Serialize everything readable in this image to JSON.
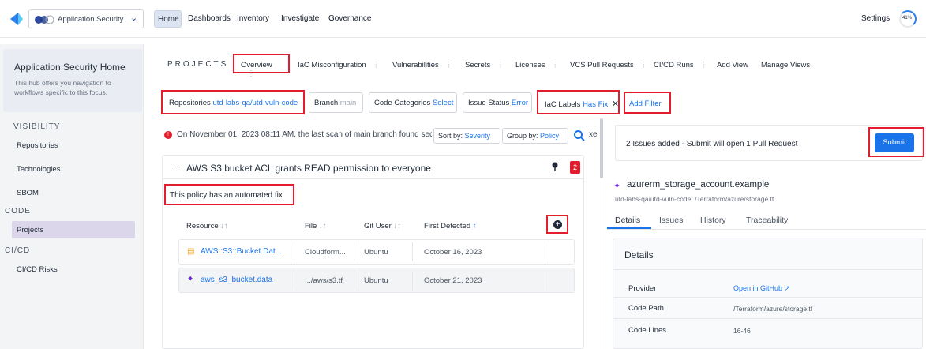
{
  "topbar": {
    "workspace": "Application Security",
    "nav": [
      "Home",
      "Dashboards",
      "Inventory",
      "Investigate",
      "Governance"
    ],
    "settings": "Settings",
    "avatar_percent": "41%"
  },
  "sidebar": {
    "title": "Application Security Home",
    "description": "This hub offers you navigation to workflows specific to this focus.",
    "sections": [
      {
        "heading": "VISIBILITY",
        "items": [
          "Repositories",
          "Technologies",
          "SBOM"
        ]
      },
      {
        "heading": "CODE",
        "items": [
          "Projects"
        ]
      },
      {
        "heading": "CI/CD",
        "items": [
          "CI/CD Risks"
        ]
      }
    ]
  },
  "tabs": {
    "label": "PROJECTS",
    "items": [
      "Overview",
      "IaC Misconfiguration",
      "Vulnerabilities",
      "Secrets",
      "Licenses",
      "VCS Pull Requests",
      "CI/CD Runs"
    ],
    "add_view": "Add View",
    "manage_views": "Manage Views"
  },
  "filters": {
    "repositories_label": "Repositories",
    "repositories_value": "utd-labs-qa/utd-vuln-code",
    "branch_label": "Branch",
    "branch_value": "main",
    "code_categories_label": "Code Categories",
    "code_categories_value": "Select",
    "issue_status_label": "Issue Status",
    "issue_status_value": "Error",
    "iac_labels_label": "IaC Labels",
    "iac_labels_value": "Has Fix",
    "add_filter": "Add Filter"
  },
  "scan": {
    "notice": "On November 01, 2023 08:11 AM, the last scan of main branch found sec",
    "sort_label": "Sort by:",
    "sort_value": "Severity",
    "group_label": "Group by:",
    "group_value": "Policy",
    "trailing": "xe"
  },
  "policy": {
    "title": "AWS S3 bucket ACL grants READ permission to everyone",
    "count": "2",
    "fix_note": "This policy has an automated fix"
  },
  "table": {
    "headers": [
      "Resource",
      "File",
      "Git User",
      "First Detected"
    ],
    "rows": [
      {
        "resource": "AWS::S3::Bucket.Dat...",
        "file": "Cloudform...",
        "user": "Ubuntu",
        "date": "October 16, 2023"
      },
      {
        "resource": "aws_s3_bucket.data",
        "file": ".../aws/s3.tf",
        "user": "Ubuntu",
        "date": "October 21, 2023"
      }
    ]
  },
  "right": {
    "issues_added": "2 Issues added - Submit will open 1 Pull Request",
    "submit": "Submit",
    "resource_name": "azurerm_storage_account.example",
    "resource_path": "utd-labs-qa/utd-vuln-code: /Terraform/azure/storage.tf",
    "tabs": [
      "Details",
      "Issues",
      "History",
      "Traceability"
    ],
    "details_heading": "Details",
    "details": [
      {
        "key": "Provider",
        "value": "Open in GitHub"
      },
      {
        "key": "Code Path",
        "value": "/Terraform/azure/storage.tf"
      },
      {
        "key": "Code Lines",
        "value": "16-46"
      }
    ]
  },
  "colors": {
    "accent": "#1a73e8",
    "highlight": "#e11d2e",
    "submit": "#1a73e8"
  }
}
